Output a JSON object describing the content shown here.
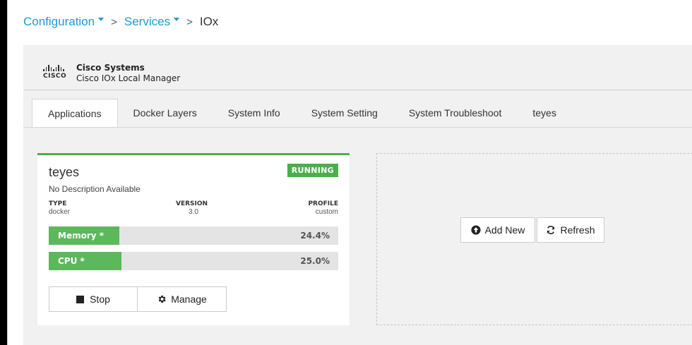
{
  "breadcrumb": {
    "configuration": "Configuration",
    "services": "Services",
    "current": "IOx",
    "separator": ">"
  },
  "brand": {
    "logo_word": "CISCO",
    "company": "Cisco Systems",
    "product": "Cisco IOx Local Manager"
  },
  "tabs": [
    {
      "label": "Applications",
      "active": true
    },
    {
      "label": "Docker Layers",
      "active": false
    },
    {
      "label": "System Info",
      "active": false
    },
    {
      "label": "System Setting",
      "active": false
    },
    {
      "label": "System Troubleshoot",
      "active": false
    },
    {
      "label": "teyes",
      "active": false
    }
  ],
  "app_card": {
    "name": "teyes",
    "status": "RUNNING",
    "description": "No Description Available",
    "type_label": "TYPE",
    "type_value": "docker",
    "version_label": "VERSION",
    "version_value": "3.0",
    "profile_label": "PROFILE",
    "profile_value": "custom",
    "memory": {
      "label": "Memory *",
      "value": "24.4%"
    },
    "cpu": {
      "label": "CPU *",
      "value": "25.0%"
    },
    "stop_label": "Stop",
    "manage_label": "Manage"
  },
  "actions": {
    "add_new_label": "Add New",
    "refresh_label": "Refresh"
  },
  "colors": {
    "link": "#1a9bd7",
    "running": "#4cae4c",
    "usage_fill": "#5cb85c",
    "usage_track": "#e4e4e4"
  },
  "icons": {
    "stop": "stop-icon",
    "manage": "gear-icon",
    "add_new": "arrow-up-circle-icon",
    "refresh": "refresh-icon",
    "caret": "caret-down-icon"
  }
}
